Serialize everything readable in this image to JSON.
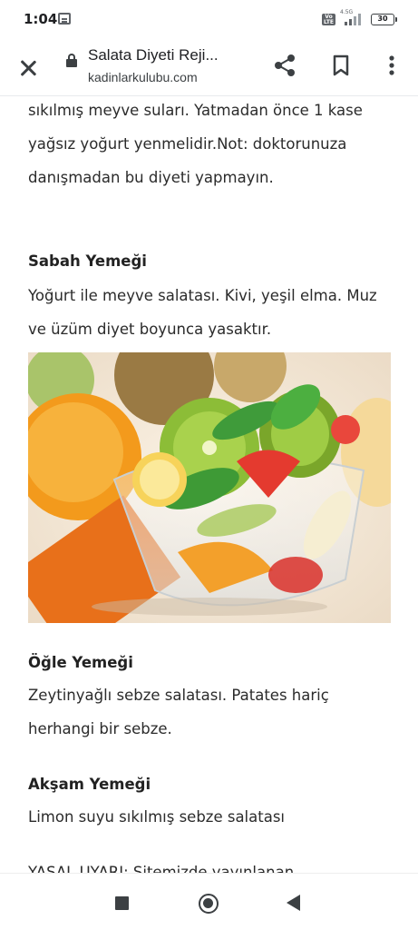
{
  "status_bar": {
    "time": "1:04",
    "volte": "Vo LTE",
    "network": "4.5G",
    "battery": "30"
  },
  "toolbar": {
    "title": "Salata Diyeti Reji...",
    "url": "kadinlarkulubu.com"
  },
  "article": {
    "intro_text": "sıkılmış meyve suları. Yatmadan önce 1 kase yağsız yoğurt yenmelidir.Not: doktorunuza danışmadan bu diyeti yapmayın.",
    "breakfast_heading": "Sabah Yemeği",
    "breakfast_text": "Yoğurt ile meyve salatası. Kivi, yeşil elma. Muz ve üzüm diyet boyunca yasaktır.",
    "lunch_heading": "Öğle Yemeği",
    "lunch_text": "Zeytinyağlı sebze salatası. Patates hariç herhangi bir sebze.",
    "dinner_heading": "Akşam Yemeği",
    "dinner_text": "Limon suyu sıkılmış sebze salatası",
    "legal_text": "YASAL UYARI: Sitemizde yayınlanan"
  },
  "icons": {
    "close": "close-icon",
    "lock": "lock-icon",
    "share": "share-icon",
    "bookmark": "bookmark-icon",
    "more": "more-vert-icon",
    "nav_recents": "square-icon",
    "nav_home": "circle-icon",
    "nav_back": "triangle-back-icon"
  },
  "colors": {
    "text": "#2b2b2b",
    "heading": "#222222",
    "toolbar_icon": "#3c4043"
  }
}
